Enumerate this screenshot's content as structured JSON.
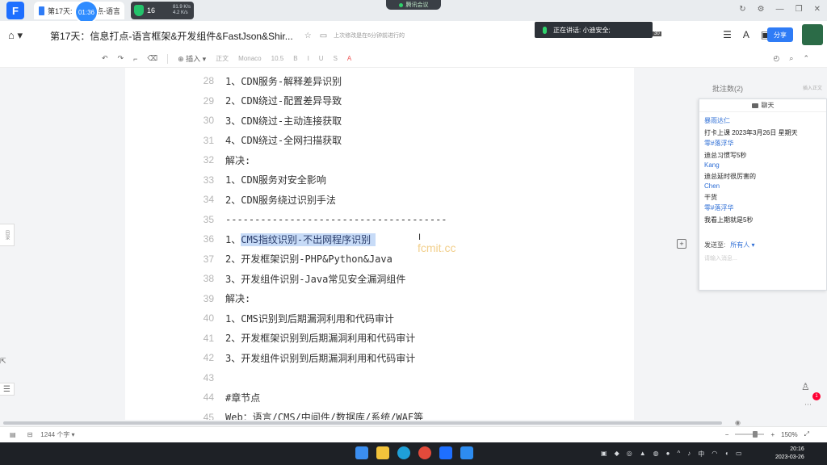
{
  "tabbar": {
    "app_logo": "F",
    "tab_title": "第17天: 信息打点-语言框架...",
    "timer": "01:36",
    "net_value": "16",
    "net_up": "81.9 K/s",
    "net_down": "4.2 K/s",
    "meeting_label": "腾讯会议",
    "window_controls": [
      "↻",
      "⚙",
      "—",
      "❐",
      "✕"
    ]
  },
  "titlerow": {
    "title": "第17天：信息打点-语言框架&开发组件&FastJson&Shir...",
    "save_status": "上次修改是在6分钟前进行的",
    "speaking": "正在讲话: 小迪安全;",
    "viewer_count": "30",
    "share_label": "分享"
  },
  "toolbar": {
    "insert_label": "插入 ▾",
    "style": "正文",
    "font": "Monaco",
    "size": "10.5",
    "buttons": [
      "B",
      "I",
      "U",
      "S",
      "A"
    ]
  },
  "document": {
    "lines": [
      {
        "num": "28",
        "text": "1、CDN服务-解释差异识别"
      },
      {
        "num": "29",
        "text": "2、CDN绕过-配置差异导致"
      },
      {
        "num": "30",
        "text": "3、CDN绕过-主动连接获取"
      },
      {
        "num": "31",
        "text": "4、CDN绕过-全网扫描获取"
      },
      {
        "num": "32",
        "text": "解决:"
      },
      {
        "num": "33",
        "text": "1、CDN服务对安全影响"
      },
      {
        "num": "34",
        "text": "2、CDN服务绕过识别手法"
      },
      {
        "num": "35",
        "text": "--------------------------------------"
      },
      {
        "num": "36",
        "prefix": "1、",
        "text": "CMS指纹识别-不出网程序识别"
      },
      {
        "num": "37",
        "text": "2、开发框架识别-PHP&Python&Java"
      },
      {
        "num": "38",
        "text": "3、开发组件识别-Java常见安全漏洞组件"
      },
      {
        "num": "39",
        "text": "解决:"
      },
      {
        "num": "40",
        "text": "1、CMS识别到后期漏洞利用和代码审计"
      },
      {
        "num": "41",
        "text": "2、开发框架识别到后期漏洞利用和代码审计"
      },
      {
        "num": "42",
        "text": "3、开发组件识别到后期漏洞利用和代码审计"
      },
      {
        "num": "43",
        "text": ""
      },
      {
        "num": "44",
        "text": "#章节点"
      },
      {
        "num": "45",
        "text": "Web：语言/CMS/中间件/数据库/系统/WAF等"
      }
    ],
    "watermark": "fcmit.cc"
  },
  "left_dock": {
    "tab_label": "目录"
  },
  "comments": {
    "header": "批注数(2)",
    "add_label": "插入正文"
  },
  "chat": {
    "title": "聊天",
    "messages": [
      {
        "name": "暴雨达仁",
        "text": "打卡上课 2023年3月26日 星期天"
      },
      {
        "name": "零#落浮华",
        "text": "迪总习惯写5秒"
      },
      {
        "name": "Kang",
        "text": "迪总延时很厉害的"
      },
      {
        "name": "Chen",
        "text": "干货"
      },
      {
        "name": "零#落浮华",
        "text": "我看上期就是5秒"
      }
    ],
    "send_to_label": "发送至:",
    "send_target": "所有人 ▾",
    "input_placeholder": "请输入消息..."
  },
  "floating": {
    "badge": "1"
  },
  "statusbar": {
    "word_count": "1244 个字 ▾",
    "zoom": "150%"
  },
  "taskbar": {
    "time": "20:16",
    "date": "2023-03-26",
    "lang": "中"
  }
}
